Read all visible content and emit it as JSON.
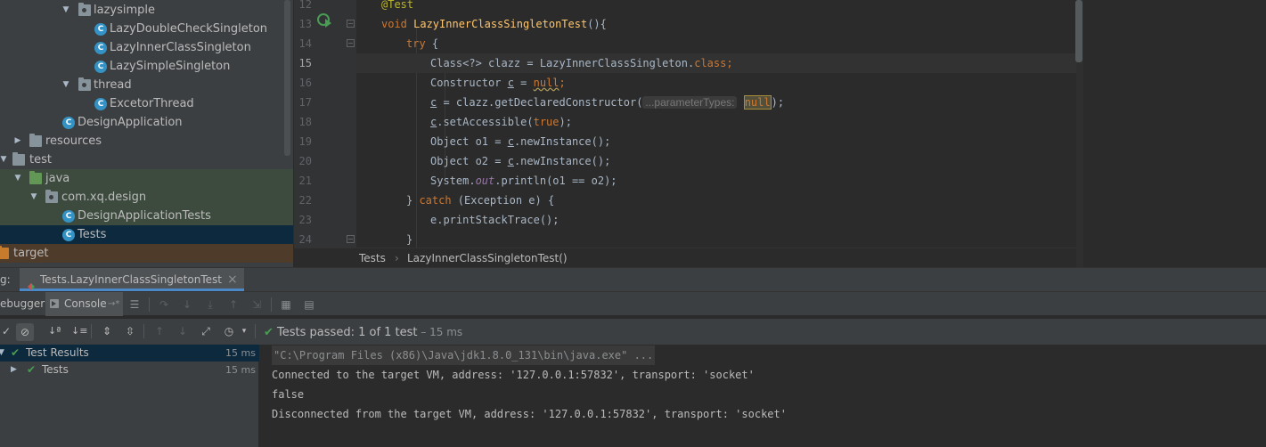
{
  "project_tree": {
    "items": [
      {
        "label": "lazysimple"
      },
      {
        "label": "LazyDoubleCheckSingleton"
      },
      {
        "label": "LazyInnerClassSingleton"
      },
      {
        "label": "LazySimpleSingleton"
      },
      {
        "label": "thread"
      },
      {
        "label": "ExcetorThread"
      },
      {
        "label": "DesignApplication"
      },
      {
        "label": "resources"
      },
      {
        "label": "test"
      },
      {
        "label": "java"
      },
      {
        "label": "com.xq.design"
      },
      {
        "label": "DesignApplicationTests"
      },
      {
        "label": "Tests"
      },
      {
        "label": "target"
      }
    ],
    "class_icon_glyph": "C"
  },
  "editor": {
    "line_numbers": [
      "12",
      "13",
      "14",
      "15",
      "16",
      "17",
      "18",
      "19",
      "20",
      "21",
      "22",
      "23",
      "24"
    ],
    "code": {
      "l12_ann": "@Test",
      "l13_kw": "void ",
      "l13_fn": "LazyInnerClassSingletonTest",
      "l13_rest": "(){",
      "l14_kw": "try",
      "l14_rest": " {",
      "l15_a": "Class<?> clazz = LazyInnerClassSingleton.",
      "l15_kw": "class",
      "l15_semi": ";",
      "l16_a": "Constructor ",
      "l16_var": "c",
      "l16_b": " = ",
      "l16_null": "null",
      "l16_semi": ";",
      "l17_var": "c",
      "l17_a": " = clazz.getDeclaredConstructor(",
      "l17_hint": "...parameterTypes:",
      "l17_null": "null",
      "l17_b": ");",
      "l18_var": "c",
      "l18_a": ".setAccessible(",
      "l18_true": "true",
      "l18_b": ");",
      "l19_a": "Object o1 = ",
      "l19_var": "c",
      "l19_b": ".newInstance();",
      "l20_a": "Object o2 = ",
      "l20_var": "c",
      "l20_b": ".newInstance();",
      "l21_a": "System.",
      "l21_out": "out",
      "l21_b": ".println(o1 == o2);",
      "l22_a": "} ",
      "l22_kw": "catch",
      "l22_b": " (Exception e) {",
      "l23": "e.printStackTrace();",
      "l24": "}"
    },
    "breadcrumb": {
      "class_name": "Tests",
      "separator": "›",
      "method_name": "LazyInnerClassSingletonTest()"
    }
  },
  "run_panel": {
    "title_prefix": "g:",
    "run_tab_label": "Tests.LazyInnerClassSingletonTest",
    "close_glyph": "×",
    "tabs": {
      "debugger_label": "ebugger",
      "console_label": "Console",
      "console_suffix": "→*"
    },
    "status": {
      "bold": "Tests passed:",
      "count": " 1 of 1 test",
      "duration": " – 15 ms"
    },
    "results": [
      {
        "label": "Test Results",
        "time": "15 ms"
      },
      {
        "label": "Tests",
        "time": "15 ms"
      }
    ],
    "console_lines": [
      "\"C:\\Program Files (x86)\\Java\\jdk1.8.0_131\\bin\\java.exe\" ...",
      "Connected to the target VM, address: '127.0.0.1:57832', transport: 'socket'",
      "false",
      "Disconnected from the target VM, address: '127.0.0.1:57832', transport: 'socket'"
    ]
  },
  "colors": {
    "panel_bg": "#3c3f41",
    "editor_bg": "#2b2b2b",
    "keyword": "#cc7832",
    "annotation": "#bbb529",
    "method": "#ffc66d",
    "field": "#9876aa",
    "class_icon": "#3592c4",
    "pass_green": "#499c54",
    "selection": "#0d293e"
  }
}
